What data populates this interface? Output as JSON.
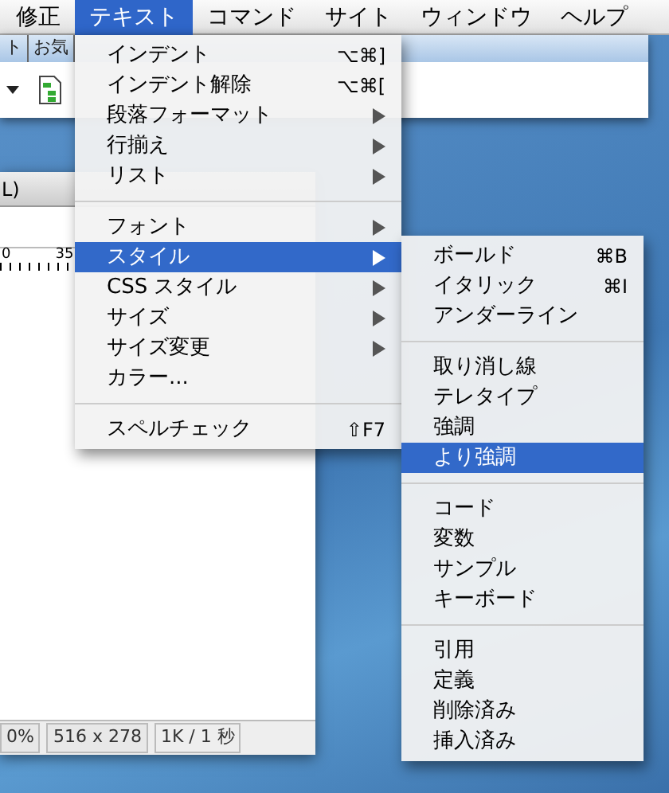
{
  "menu_bar": [
    {
      "label": "修正",
      "selected": false
    },
    {
      "label": "テキスト",
      "selected": true
    },
    {
      "label": "コマンド",
      "selected": false
    },
    {
      "label": "サイト",
      "selected": false
    },
    {
      "label": "ウィンドウ",
      "selected": false
    },
    {
      "label": "ヘルプ",
      "selected": false
    }
  ],
  "toolbar_window": {
    "tabs": [
      "ト",
      "お気"
    ]
  },
  "document_window": {
    "title": "L)",
    "ruler_labels": [
      "0",
      "35"
    ],
    "status_bar": {
      "zoom": "0%",
      "size": "516 x 278",
      "download": "1K / 1 秒"
    }
  },
  "text_menu": {
    "groups": [
      [
        {
          "label": "インデント",
          "shortcut": "⌥⌘]",
          "submenu": false,
          "selected": false
        },
        {
          "label": "インデント解除",
          "shortcut": "⌥⌘[",
          "submenu": false,
          "selected": false
        },
        {
          "label": "段落フォーマット",
          "submenu": true,
          "selected": false
        },
        {
          "label": "行揃え",
          "submenu": true,
          "selected": false
        },
        {
          "label": "リスト",
          "submenu": true,
          "selected": false
        }
      ],
      [
        {
          "label": "フォント",
          "submenu": true,
          "selected": false
        },
        {
          "label": "スタイル",
          "submenu": true,
          "selected": true
        },
        {
          "label": "CSS スタイル",
          "submenu": true,
          "selected": false
        },
        {
          "label": "サイズ",
          "submenu": true,
          "selected": false
        },
        {
          "label": "サイズ変更",
          "submenu": true,
          "selected": false
        },
        {
          "label": "カラー...",
          "submenu": false,
          "selected": false
        }
      ],
      [
        {
          "label": "スペルチェック",
          "shortcut": "⇧F7",
          "submenu": false,
          "selected": false
        }
      ]
    ]
  },
  "style_submenu": {
    "groups": [
      [
        {
          "label": "ボールド",
          "shortcut": "⌘B",
          "selected": false
        },
        {
          "label": "イタリック",
          "shortcut": "⌘I",
          "selected": false
        },
        {
          "label": "アンダーライン",
          "selected": false
        }
      ],
      [
        {
          "label": "取り消し線",
          "selected": false
        },
        {
          "label": "テレタイプ",
          "selected": false
        },
        {
          "label": "強調",
          "selected": false
        },
        {
          "label": "より強調",
          "selected": true
        }
      ],
      [
        {
          "label": "コード",
          "selected": false
        },
        {
          "label": "変数",
          "selected": false
        },
        {
          "label": "サンプル",
          "selected": false
        },
        {
          "label": "キーボード",
          "selected": false
        }
      ],
      [
        {
          "label": "引用",
          "selected": false
        },
        {
          "label": "定義",
          "selected": false
        },
        {
          "label": "削除済み",
          "selected": false
        },
        {
          "label": "挿入済み",
          "selected": false
        }
      ]
    ]
  }
}
